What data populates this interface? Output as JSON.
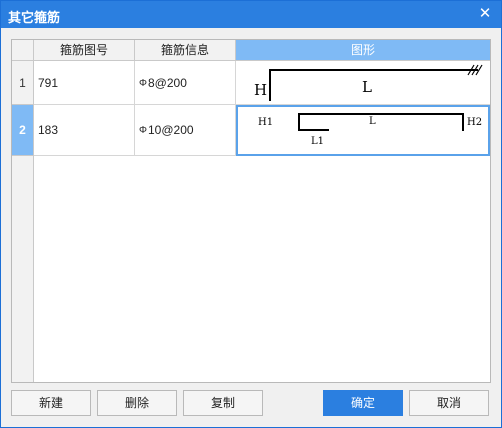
{
  "window": {
    "title": "其它箍筋",
    "close_icon": "✕"
  },
  "table": {
    "headers": [
      "箍筋图号",
      "箍筋信息",
      "图形"
    ],
    "rows": [
      {
        "no": "1",
        "code": "791",
        "info_symbol": "Φ",
        "info": "8@200"
      },
      {
        "no": "2",
        "code": "183",
        "info_symbol": "Φ",
        "info": "10@200"
      }
    ]
  },
  "shapes": {
    "row1": {
      "h": "H",
      "l": "L"
    },
    "row2": {
      "h1": "H1",
      "l": "L",
      "h2": "H2",
      "l1": "L1"
    }
  },
  "buttons": {
    "new": "新建",
    "delete": "删除",
    "copy": "复制",
    "ok": "确定",
    "cancel": "取消"
  },
  "colors": {
    "titlebar": "#2b7fe0",
    "selected_header": "#7fbaf5",
    "primary_button": "#2b7fe0"
  }
}
